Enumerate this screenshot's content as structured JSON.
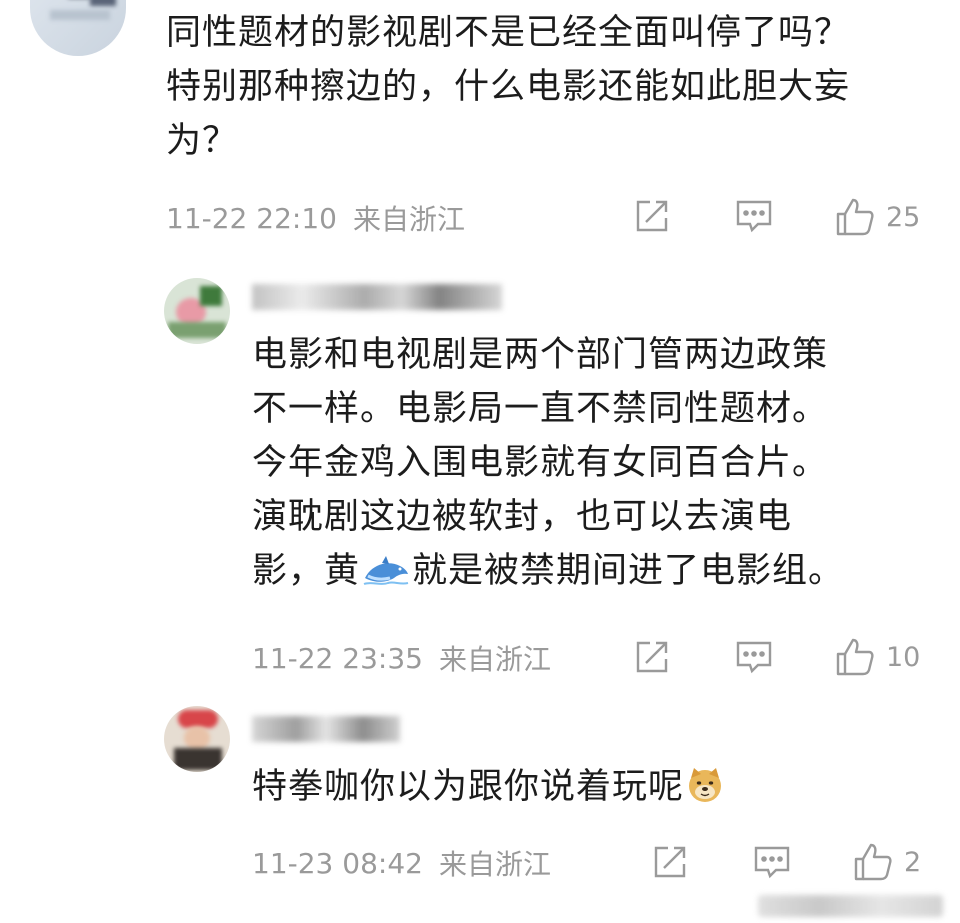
{
  "comments": [
    {
      "text": "同性题材的影视剧不是已经全面叫停了吗？\n特别那种擦边的，什么电影还能如此胆大妄\n为？",
      "time": "11-22 22:10",
      "location": "来自浙江",
      "likes": "25"
    },
    {
      "text_part1": "电影和电视剧是两个部门管两边政策\n不一样。电影局一直不禁同性题材。\n今年金鸡入围电影就有女同百合片。\n演耽剧这边被软封，也可以去演电\n影，黄",
      "text_emoji": "dolphin-emoji",
      "text_part2": "就是被禁期间进了电影组。",
      "time": "11-22 23:35",
      "location": "来自浙江",
      "likes": "10"
    },
    {
      "text": "特拳咖你以为跟你说着玩呢",
      "emoji": "doge-emoji",
      "time": "11-23 08:42",
      "location": "来自浙江",
      "likes": "2"
    }
  ],
  "icons": {
    "share": "share-icon",
    "reply": "comment-icon",
    "like": "thumbs-up-icon"
  },
  "colors": {
    "text": "#1c1c1c",
    "meta": "#9a9a9a",
    "background": "#ffffff"
  }
}
